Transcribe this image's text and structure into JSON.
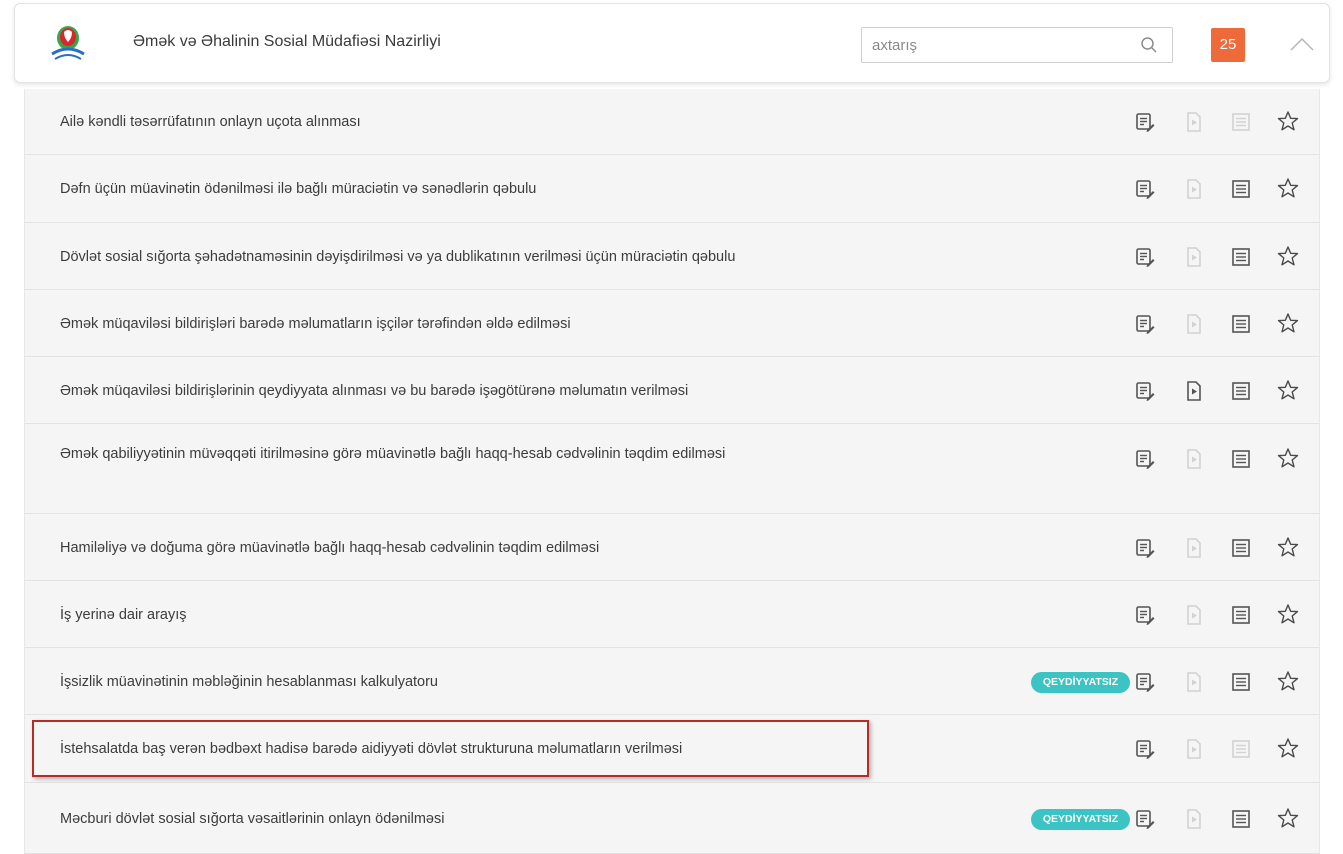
{
  "header": {
    "org_title": "Əmək və Əhalinin Sosial Müdafiəsi Nazirliyi",
    "search_placeholder": "axtarış",
    "count": "25"
  },
  "colors": {
    "count_badge": "#ef6a3a",
    "tag_badge": "#3cc3c3",
    "highlight_border": "#b82a2a",
    "list_background": "#f5f5f5"
  },
  "icons": [
    "logo-icon",
    "search-icon",
    "chevron-up-icon",
    "list-edit-icon",
    "play-document-icon",
    "document-list-icon",
    "star-icon"
  ],
  "services": [
    {
      "title": "Ailə kəndli təsərrüfatının onlayn uçota alınması",
      "tag": "",
      "play_active": false,
      "list_active": false
    },
    {
      "title": "Dəfn üçün müavinətin ödənilməsi ilə bağlı müraciətin və sənədlərin qəbulu",
      "tag": "",
      "play_active": false,
      "list_active": true
    },
    {
      "title": "Dövlət sosial sığorta şəhadətnaməsinin dəyişdirilməsi və ya dublikatının verilməsi üçün müraciətin qəbulu",
      "tag": "",
      "play_active": false,
      "list_active": true
    },
    {
      "title": "Əmək müqaviləsi bildirişləri barədə məlumatların işçilər tərəfindən əldə edilməsi",
      "tag": "",
      "play_active": false,
      "list_active": true
    },
    {
      "title": "Əmək müqaviləsi bildirişlərinin qeydiyyata alınması və bu barədə işəgötürənə məlumatın verilməsi",
      "tag": "",
      "play_active": true,
      "list_active": true
    },
    {
      "title": "Əmək qabiliyyətinin müvəqqəti itirilməsinə görə müavinətlə bağlı haqq-hesab cədvəlinin təqdim edilməsi",
      "tag": "",
      "play_active": false,
      "list_active": true
    },
    {
      "title": "Hamiləliyə və doğuma görə müavinətlə bağlı haqq-hesab cədvəlinin təqdim edilməsi",
      "tag": "",
      "play_active": false,
      "list_active": true
    },
    {
      "title": "İş yerinə dair arayış",
      "tag": "",
      "play_active": false,
      "list_active": true
    },
    {
      "title": "İşsizlik müavinətinin məbləğinin hesablanması kalkulyatoru",
      "tag": "QEYDİYYATSIZ",
      "play_active": false,
      "list_active": true
    },
    {
      "title": "İstehsalatda baş verən bədbəxt hadisə barədə aidiyyəti dövlət strukturuna məlumatların verilməsi",
      "tag": "",
      "play_active": false,
      "list_active": false
    },
    {
      "title": "Məcburi dövlət sosial sığorta vəsaitlərinin onlayn ödənilməsi",
      "tag": "QEYDİYYATSIZ",
      "play_active": false,
      "list_active": true
    }
  ]
}
